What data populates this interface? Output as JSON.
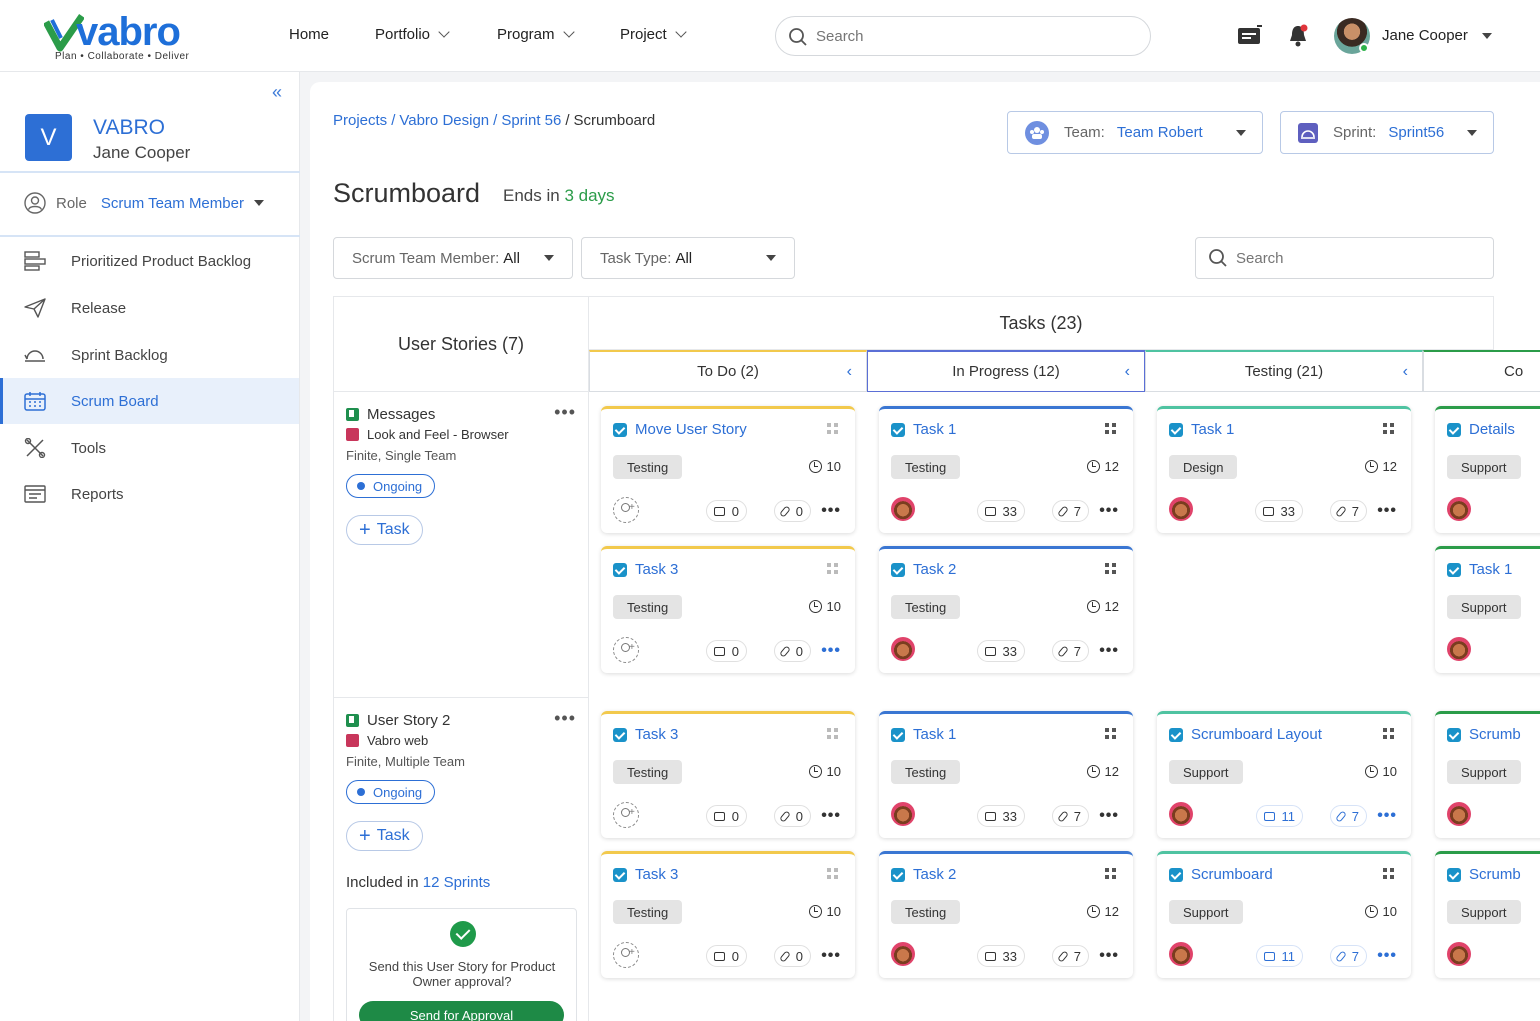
{
  "brand": {
    "name": "vabro",
    "tagline": "Plan • Collaborate • Deliver"
  },
  "nav": {
    "home": "Home",
    "portfolio": "Portfolio",
    "program": "Program",
    "project": "Project"
  },
  "top_search": {
    "placeholder": "Search"
  },
  "user": {
    "name": "Jane Cooper"
  },
  "sidebar": {
    "workspace_initial": "V",
    "workspace_name": "VABRO",
    "workspace_user": "Jane Cooper",
    "role_label": "Role",
    "role_value": "Scrum Team Member",
    "items": [
      {
        "label": "Prioritized Product Backlog",
        "icon": "backlog-icon"
      },
      {
        "label": "Release",
        "icon": "paper-plane-icon"
      },
      {
        "label": "Sprint Backlog",
        "icon": "sprint-icon"
      },
      {
        "label": "Scrum Board",
        "icon": "calendar-icon",
        "active": true
      },
      {
        "label": "Tools",
        "icon": "tools-icon"
      },
      {
        "label": "Reports",
        "icon": "reports-icon"
      }
    ]
  },
  "breadcrumb": {
    "projects": "Projects",
    "project": "Vabro Design",
    "sprint": "Sprint 56",
    "current": "Scrumboard"
  },
  "team_select": {
    "label": "Team:",
    "value": "Team Robert"
  },
  "sprint_select": {
    "label": "Sprint:",
    "value": "Sprint56"
  },
  "page": {
    "title": "Scrumboard",
    "ends_prefix": "Ends in",
    "ends_value": "3 days"
  },
  "filters": {
    "member_label": "Scrum Team Member:",
    "member_value": "All",
    "type_label": "Task Type:",
    "type_value": "All",
    "search_placeholder": "Search"
  },
  "board": {
    "user_stories_header": "User Stories (7)",
    "tasks_header": "Tasks (23)",
    "columns": [
      {
        "label": "To Do (2)",
        "color": "#f2c94c"
      },
      {
        "label": "In Progress (12)",
        "color": "#5b6fd6"
      },
      {
        "label": "Testing (21)",
        "color": "#4fc3a1"
      },
      {
        "label": "Co",
        "color": "#2b9c49"
      }
    ]
  },
  "stories": [
    {
      "title": "Messages",
      "project": "Look and Feel - Browser",
      "meta": "Finite, Single Team",
      "status": "Ongoing",
      "add_task": "Task"
    },
    {
      "title": "User Story 2",
      "project": "Vabro web",
      "meta": "Finite, Multiple Team",
      "status": "Ongoing",
      "add_task": "Task",
      "included_prefix": "Included in",
      "included_value": "12 Sprints",
      "approval_text": "Send this User Story for Product Owner approval?",
      "approval_button": "Send for Approval"
    }
  ],
  "cards": {
    "r1c1": {
      "title": "Move User Story",
      "tag": "Testing",
      "estimate": "10",
      "comments": "0",
      "attachments": "0"
    },
    "r1c2": {
      "title": "Task 1",
      "tag": "Testing",
      "estimate": "12",
      "comments": "33",
      "attachments": "7"
    },
    "r1c3": {
      "title": "Task 1",
      "tag": "Design",
      "estimate": "12",
      "comments": "33",
      "attachments": "7"
    },
    "r1c4": {
      "title": "Details",
      "tag": "Support"
    },
    "r2c1": {
      "title": "Task 3",
      "tag": "Testing",
      "estimate": "10",
      "comments": "0",
      "attachments": "0"
    },
    "r2c2": {
      "title": "Task 2",
      "tag": "Testing",
      "estimate": "12",
      "comments": "33",
      "attachments": "7"
    },
    "r2c4": {
      "title": "Task 1",
      "tag": "Support"
    },
    "r3c1": {
      "title": "Task 3",
      "tag": "Testing",
      "estimate": "10",
      "comments": "0",
      "attachments": "0"
    },
    "r3c2": {
      "title": "Task 1",
      "tag": "Testing",
      "estimate": "12",
      "comments": "33",
      "attachments": "7"
    },
    "r3c3": {
      "title": "Scrumboard Layout",
      "tag": "Support",
      "estimate": "10",
      "comments": "11",
      "attachments": "7"
    },
    "r3c4": {
      "title": "Scrumb",
      "tag": "Support"
    },
    "r4c1": {
      "title": "Task 3",
      "tag": "Testing",
      "estimate": "10",
      "comments": "0",
      "attachments": "0"
    },
    "r4c2": {
      "title": "Task 2",
      "tag": "Testing",
      "estimate": "12",
      "comments": "33",
      "attachments": "7"
    },
    "r4c3": {
      "title": "Scrumboard",
      "tag": "Support",
      "estimate": "10",
      "comments": "11",
      "attachments": "7"
    },
    "r4c4": {
      "title": "Scrumb",
      "tag": "Support"
    }
  }
}
